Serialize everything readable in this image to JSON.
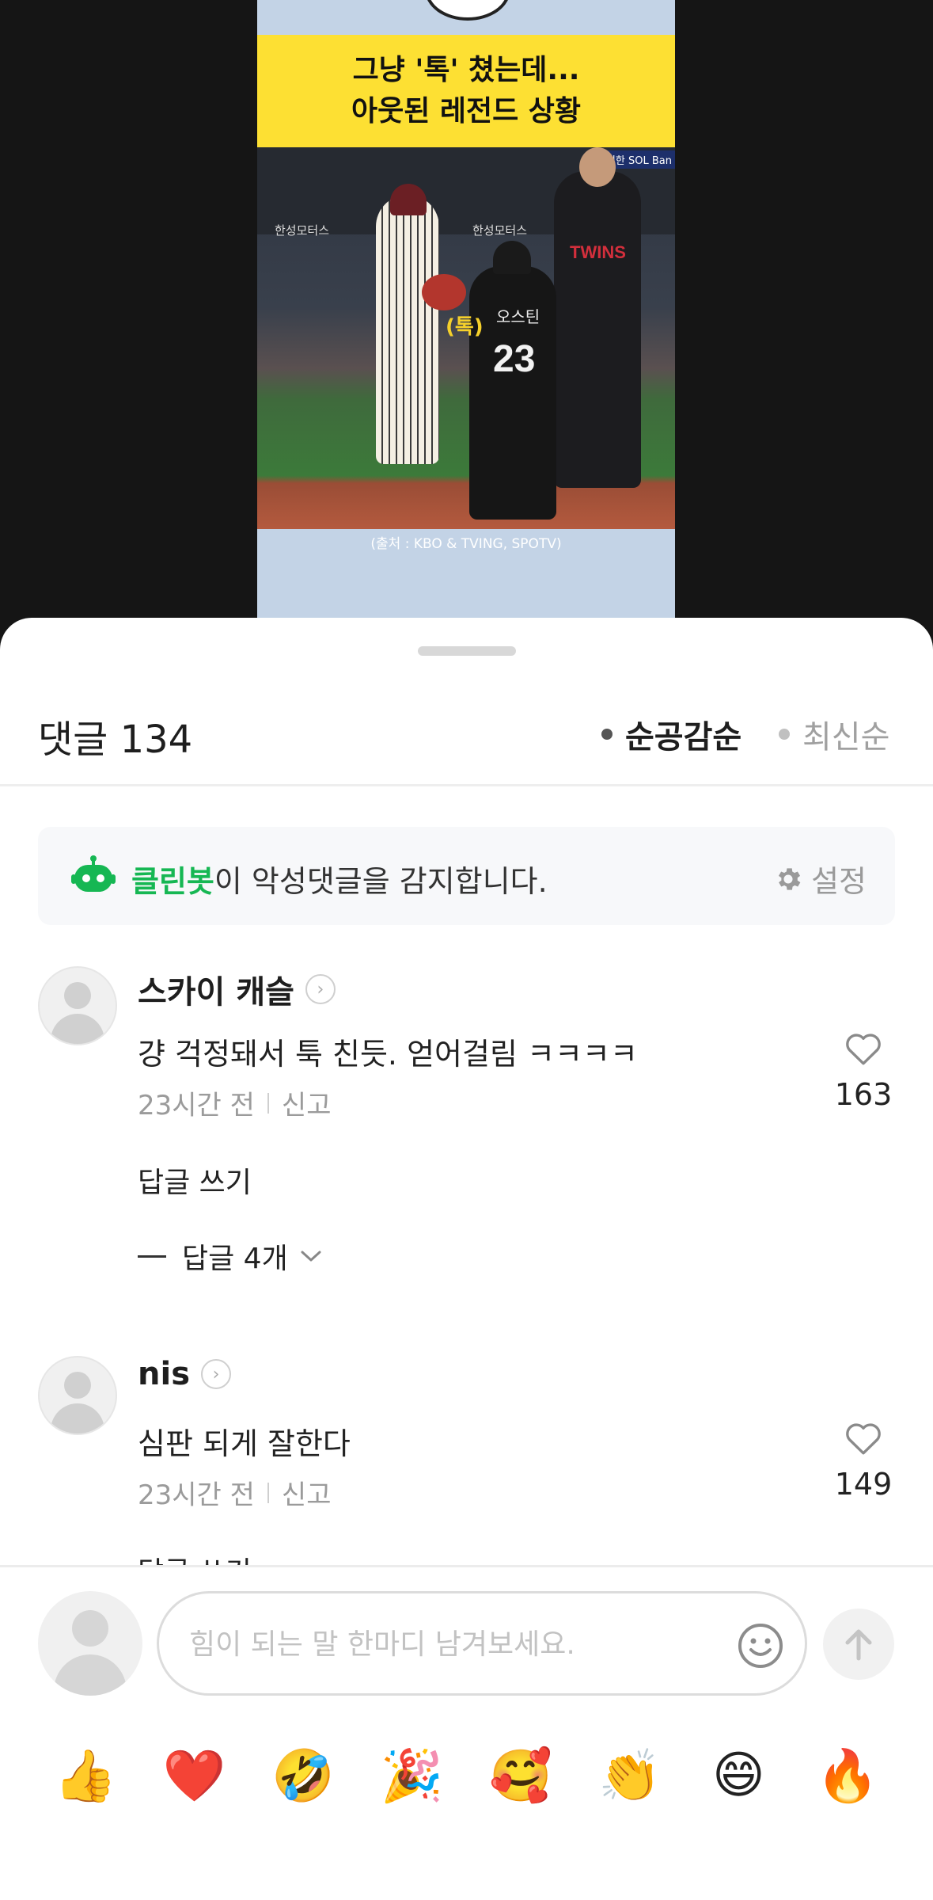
{
  "video": {
    "banner_line1": "그냥 '톡' 쳤는데...",
    "banner_line2": "아웃된 레전드 상황",
    "sign_left": "한성모터스",
    "sign_right": "한성모터스",
    "sponsor": "신한 SOL Ban",
    "jersey_team": "TWINS",
    "jersey_name": "오스틴",
    "jersey_number": "23",
    "caption": "(톡)",
    "source": "(출처 : KBO & TVING, SPOTV)"
  },
  "sheet": {
    "title": "댓글 134",
    "sort_options": [
      {
        "label": "순공감순",
        "active": true
      },
      {
        "label": "최신순",
        "active": false
      }
    ]
  },
  "cleanbot": {
    "name": "클린봇",
    "message": "이 악성댓글을 감지합니다.",
    "settings_label": "설정",
    "accent_color": "#16b753"
  },
  "comments": [
    {
      "author": "스카이 캐슬",
      "text": "걍 걱정돼서 툭 친듯. 얻어걸림 ㅋㅋㅋㅋ",
      "time": "23시간 전",
      "report": "신고",
      "likes": "163",
      "reply_label": "답글 쓰기",
      "replies_label": "답글 4개"
    },
    {
      "author": "nis",
      "text": "심판 되게 잘한다",
      "time": "23시간 전",
      "report": "신고",
      "likes": "149",
      "reply_label": "답글 쓰기"
    }
  ],
  "input": {
    "placeholder": "힘이 되는 말 한마디 남겨보세요."
  },
  "reactions": [
    "👍",
    "❤️",
    "🤣",
    "🎉",
    "🥰",
    "👏",
    "😄",
    "🔥"
  ]
}
